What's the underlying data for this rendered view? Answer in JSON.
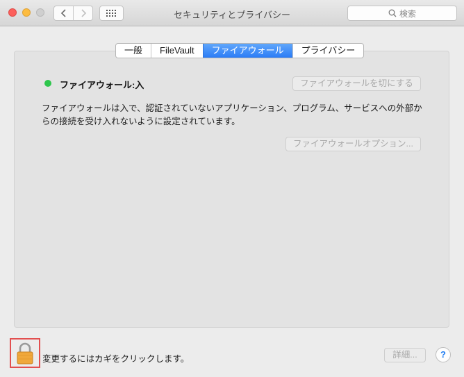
{
  "window": {
    "title": "セキュリティとプライバシー"
  },
  "search": {
    "placeholder": "検索",
    "icon": "search-icon"
  },
  "tabs": [
    {
      "label": "一般",
      "active": false
    },
    {
      "label": "FileVault",
      "active": false
    },
    {
      "label": "ファイアウォール",
      "active": true
    },
    {
      "label": "プライバシー",
      "active": false
    }
  ],
  "firewall": {
    "status_label": "ファイアウォール:入",
    "status_color": "#2ec64c",
    "turn_off_button": "ファイアウォールを切にする",
    "description": "ファイアウォールは入で、認証されていないアプリケーション、プログラム、サービスへの外部からの接続を受け入れないように設定されています。",
    "options_button": "ファイアウォールオプション..."
  },
  "footer": {
    "lock_text": "変更するにはカギをクリックします。",
    "advanced_button": "詳細...",
    "help_label": "?"
  },
  "colors": {
    "accent": "#2b7cf6",
    "highlight_box": "#e24f4f"
  }
}
